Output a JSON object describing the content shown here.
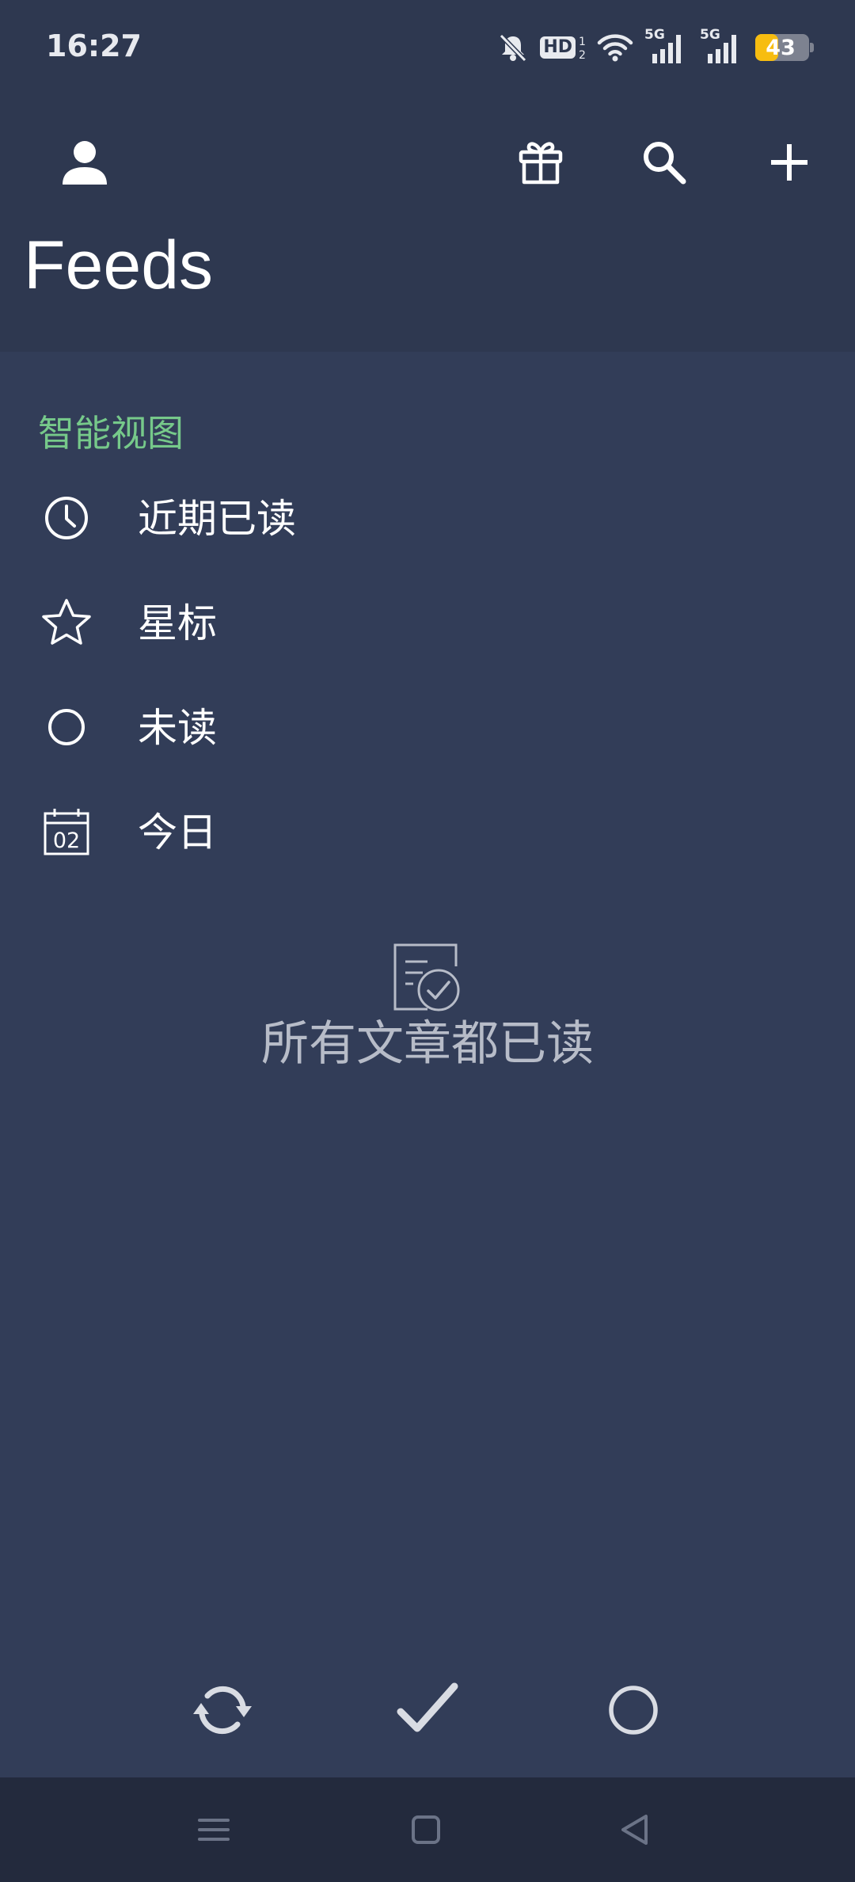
{
  "status_bar": {
    "time": "16:27",
    "battery_level": "43",
    "network_badge_1": "5G",
    "network_badge_2": "5G",
    "hd_label": "HD",
    "icons": [
      "notifications-off-icon",
      "hd-voice-icon",
      "wifi-icon",
      "signal-5g-icon",
      "signal-5g-icon",
      "battery-icon"
    ]
  },
  "toolbar": {
    "icons": [
      "account-icon",
      "gift-icon",
      "search-icon",
      "add-icon"
    ]
  },
  "header": {
    "title": "Feeds"
  },
  "smart_views": {
    "section_label": "智能视图",
    "items": [
      {
        "label": "近期已读",
        "icon": "clock-icon"
      },
      {
        "label": "星标",
        "icon": "star-icon"
      },
      {
        "label": "未读",
        "icon": "circle-icon"
      },
      {
        "label": "今日",
        "icon": "calendar-today-icon",
        "icon_text": "02"
      }
    ]
  },
  "empty_state": {
    "icon": "document-check-icon",
    "message": "所有文章都已读"
  },
  "bottom_actions": {
    "icons": [
      "refresh-icon",
      "mark-all-read-icon",
      "unread-filter-icon"
    ]
  },
  "system_nav": {
    "icons": [
      "menu-icon",
      "home-icon",
      "back-icon"
    ]
  },
  "colors": {
    "background": "#323d58",
    "header_background": "#2e3850",
    "accent": "#76c98a",
    "nav_bar": "#232a3d",
    "battery": "#f7bd10"
  }
}
